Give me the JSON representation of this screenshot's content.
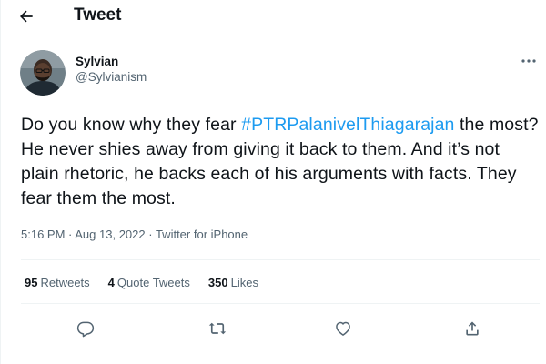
{
  "header": {
    "back_icon": "arrow-left-icon",
    "title": "Tweet"
  },
  "author": {
    "display_name": "Sylvian",
    "handle": "@Sylvianism",
    "avatar_icon": "avatar-photo"
  },
  "more_icon": "more-dots-icon",
  "tweet": {
    "text_before": "Do you know why they fear ",
    "hashtag": "#PTRPalanivelThiagarajan",
    "text_after": " the most? He never shies away from giving it back to them. And it’s not plain rhetoric, he backs each of his arguments with facts. They fear them the most."
  },
  "meta": {
    "time": "5:16 PM",
    "sep1": " · ",
    "date": "Aug 13, 2022",
    "sep2": " · ",
    "source": "Twitter for iPhone"
  },
  "stats": {
    "retweets_count": "95",
    "retweets_label": "Retweets",
    "quotes_count": "4",
    "quotes_label": "Quote Tweets",
    "likes_count": "350",
    "likes_label": "Likes"
  },
  "actions": {
    "reply_icon": "reply-icon",
    "retweet_icon": "retweet-icon",
    "like_icon": "like-icon",
    "share_icon": "share-icon"
  },
  "colors": {
    "text_primary": "#0f1419",
    "text_secondary": "#536471",
    "link": "#1d9bf0",
    "divider": "#eff3f4"
  }
}
